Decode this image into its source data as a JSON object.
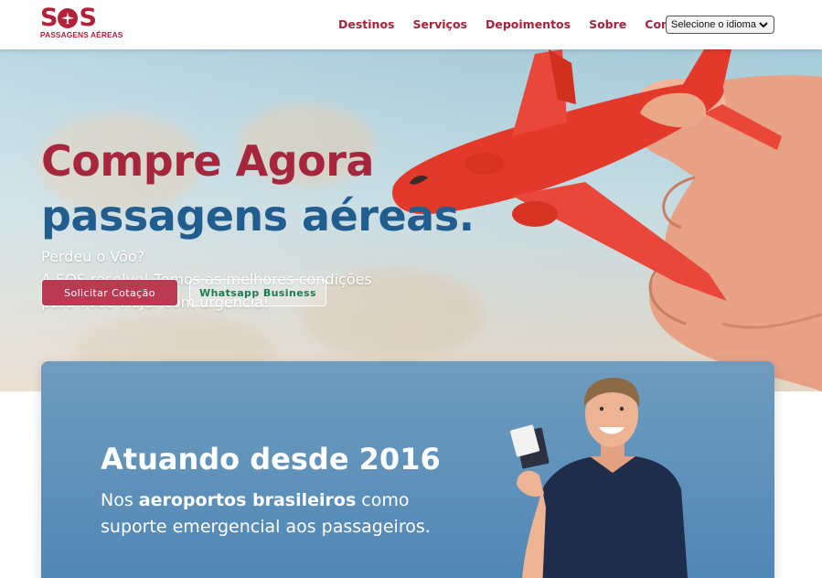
{
  "brand": {
    "logo_text": "SOS",
    "logo_sub": "PASSAGENS AÉREAS",
    "color": "#b2213a"
  },
  "nav": {
    "items": [
      {
        "label": "Destinos"
      },
      {
        "label": "Serviços"
      },
      {
        "label": "Depoimentos"
      },
      {
        "label": "Sobre"
      },
      {
        "label": "Contato"
      }
    ]
  },
  "language": {
    "selected": "Selecione o idioma"
  },
  "hero": {
    "title_line1": "Compre Agora",
    "title_line2": "passagens aéreas.",
    "subtitle_lines": [
      "Perdeu o Vôo?",
      "A SOS resolve! Temos as melhores condições",
      "para você viajar com urgência!"
    ],
    "primary_button": "Solicitar Cotação",
    "secondary_button": "Whatsapp Business"
  },
  "about": {
    "title": "Atuando desde 2016",
    "text_prefix": "Nos ",
    "text_bold": "aeroportos brasileiros",
    "text_suffix": " como",
    "text_line2": "suporte emergencial aos passageiros."
  }
}
